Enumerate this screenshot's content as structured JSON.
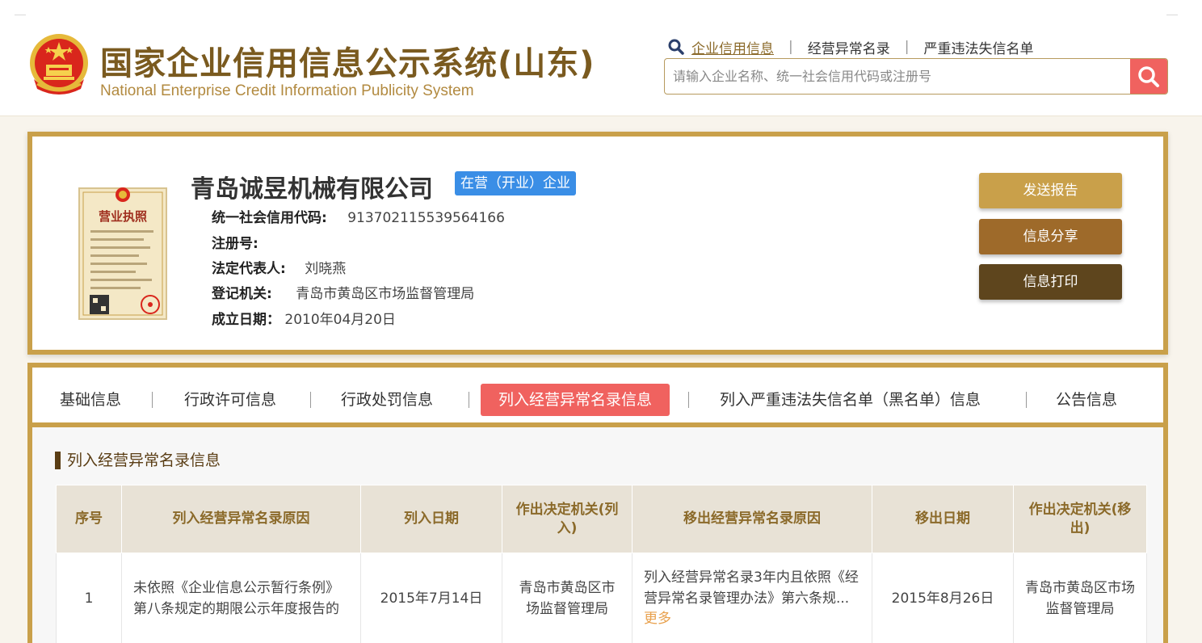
{
  "header": {
    "title_cn": "国家企业信用信息公示系统(山东)",
    "title_en": "National Enterprise Credit Information Publicity System",
    "search_tabs": [
      "企业信用信息",
      "经营异常名录",
      "严重违法失信名单"
    ],
    "search_placeholder": "请输入企业名称、统一社会信用代码或注册号"
  },
  "company": {
    "name": "青岛诚昱机械有限公司",
    "status": "在营（开业）企业",
    "license_label": "营业执照",
    "fields": [
      {
        "label": "统一社会信用代码:",
        "value": "913702115539564166"
      },
      {
        "label": "注册号:",
        "value": ""
      },
      {
        "label": "法定代表人:",
        "value": "刘晓燕"
      },
      {
        "label": "登记机关:",
        "value": "青岛市黄岛区市场监督管理局"
      },
      {
        "label": "成立日期：",
        "value": "2010年04月20日"
      }
    ],
    "actions": [
      {
        "label": "发送报告",
        "color": "#c9a04a"
      },
      {
        "label": "信息分享",
        "color": "#9e6a2a"
      },
      {
        "label": "信息打印",
        "color": "#5e451d"
      }
    ]
  },
  "tabs": [
    "基础信息",
    "行政许可信息",
    "行政处罚信息",
    "列入经营异常名录信息",
    "列入严重违法失信名单（黑名单）信息",
    "公告信息"
  ],
  "section": {
    "title": "列入经营异常名录信息",
    "columns": [
      "序号",
      "列入经营异常名录原因",
      "列入日期",
      "作出决定机关(列入)",
      "移出经营异常名录原因",
      "移出日期",
      "作出决定机关(移出)"
    ],
    "rows": [
      {
        "no": "1",
        "reason_in": "未依照《企业信息公示暂行条例》第八条规定的期限公示年度报告的",
        "date_in": "2015年7月14日",
        "authority_in": "青岛市黄岛区市场监督管理局",
        "reason_out": "列入经营异常名录3年内且依照《经营异常名录管理办法》第六条规...",
        "more": "更多",
        "date_out": "2015年8月26日",
        "authority_out": "青岛市黄岛区市场监督管理局"
      }
    ]
  },
  "colors": {
    "gold": "#c9a04a",
    "accent_red": "#f0625f",
    "status_blue": "#3a8ee6",
    "brown_text": "#7a5a1f"
  }
}
